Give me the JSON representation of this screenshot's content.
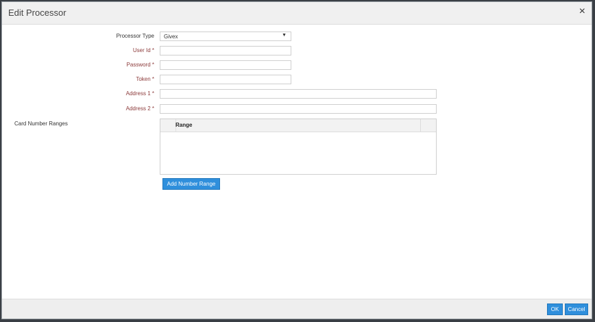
{
  "dialog": {
    "title": "Edit Processor",
    "close_icon": "×"
  },
  "form": {
    "processor_type": {
      "label": "Processor Type",
      "value": "Givex"
    },
    "user_id": {
      "label": "User Id *",
      "value": ""
    },
    "password": {
      "label": "Password *",
      "value": ""
    },
    "token": {
      "label": "Token *",
      "value": ""
    },
    "address1": {
      "label": "Address 1 *",
      "value": ""
    },
    "address2": {
      "label": "Address 2 *",
      "value": ""
    }
  },
  "card_ranges": {
    "label": "Card Number Ranges",
    "column_header": "Range",
    "rows": [],
    "add_button": "Add Number Range"
  },
  "footer": {
    "ok": "OK",
    "cancel": "Cancel"
  },
  "colors": {
    "primary_button": "#2f8fdc",
    "required_label": "#8c3b3b"
  }
}
